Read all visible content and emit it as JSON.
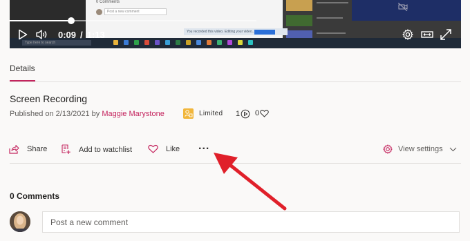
{
  "video": {
    "time_current": "0:09",
    "time_separator": "/",
    "time_total": "1:13",
    "progress_fraction": 0.12,
    "frame_comments_label": "0 Comments",
    "frame_comment_placeholder": "Post a new comment",
    "frame_toast_text": "You recorded this video. Editing your video...",
    "frame_search_placeholder": "Type here to search"
  },
  "tabs": {
    "details": "Details"
  },
  "details": {
    "title": "Screen Recording",
    "published_prefix": "Published on 2/13/2021 by",
    "author": "Maggie Marystone",
    "visibility": "Limited",
    "views": "1",
    "likes": "0"
  },
  "actions": {
    "share": "Share",
    "watchlist": "Add to watchlist",
    "like": "Like",
    "more": "...",
    "view_settings": "View settings"
  },
  "comments": {
    "heading": "0 Comments",
    "placeholder": "Post a new comment"
  },
  "colors": {
    "accent": "#c4245e",
    "badge": "#f1b63b",
    "arrow": "#e0202a"
  },
  "icons": {
    "play": "play-icon",
    "volume": "volume-icon",
    "settings": "gear-icon",
    "theater": "theater-mode-icon",
    "fullscreen": "fullscreen-icon",
    "share": "share-icon",
    "watchlist": "watchlist-icon",
    "like": "heart-icon",
    "more": "more-icon",
    "view_settings": "gear-icon",
    "chevron": "chevron-down-icon"
  }
}
